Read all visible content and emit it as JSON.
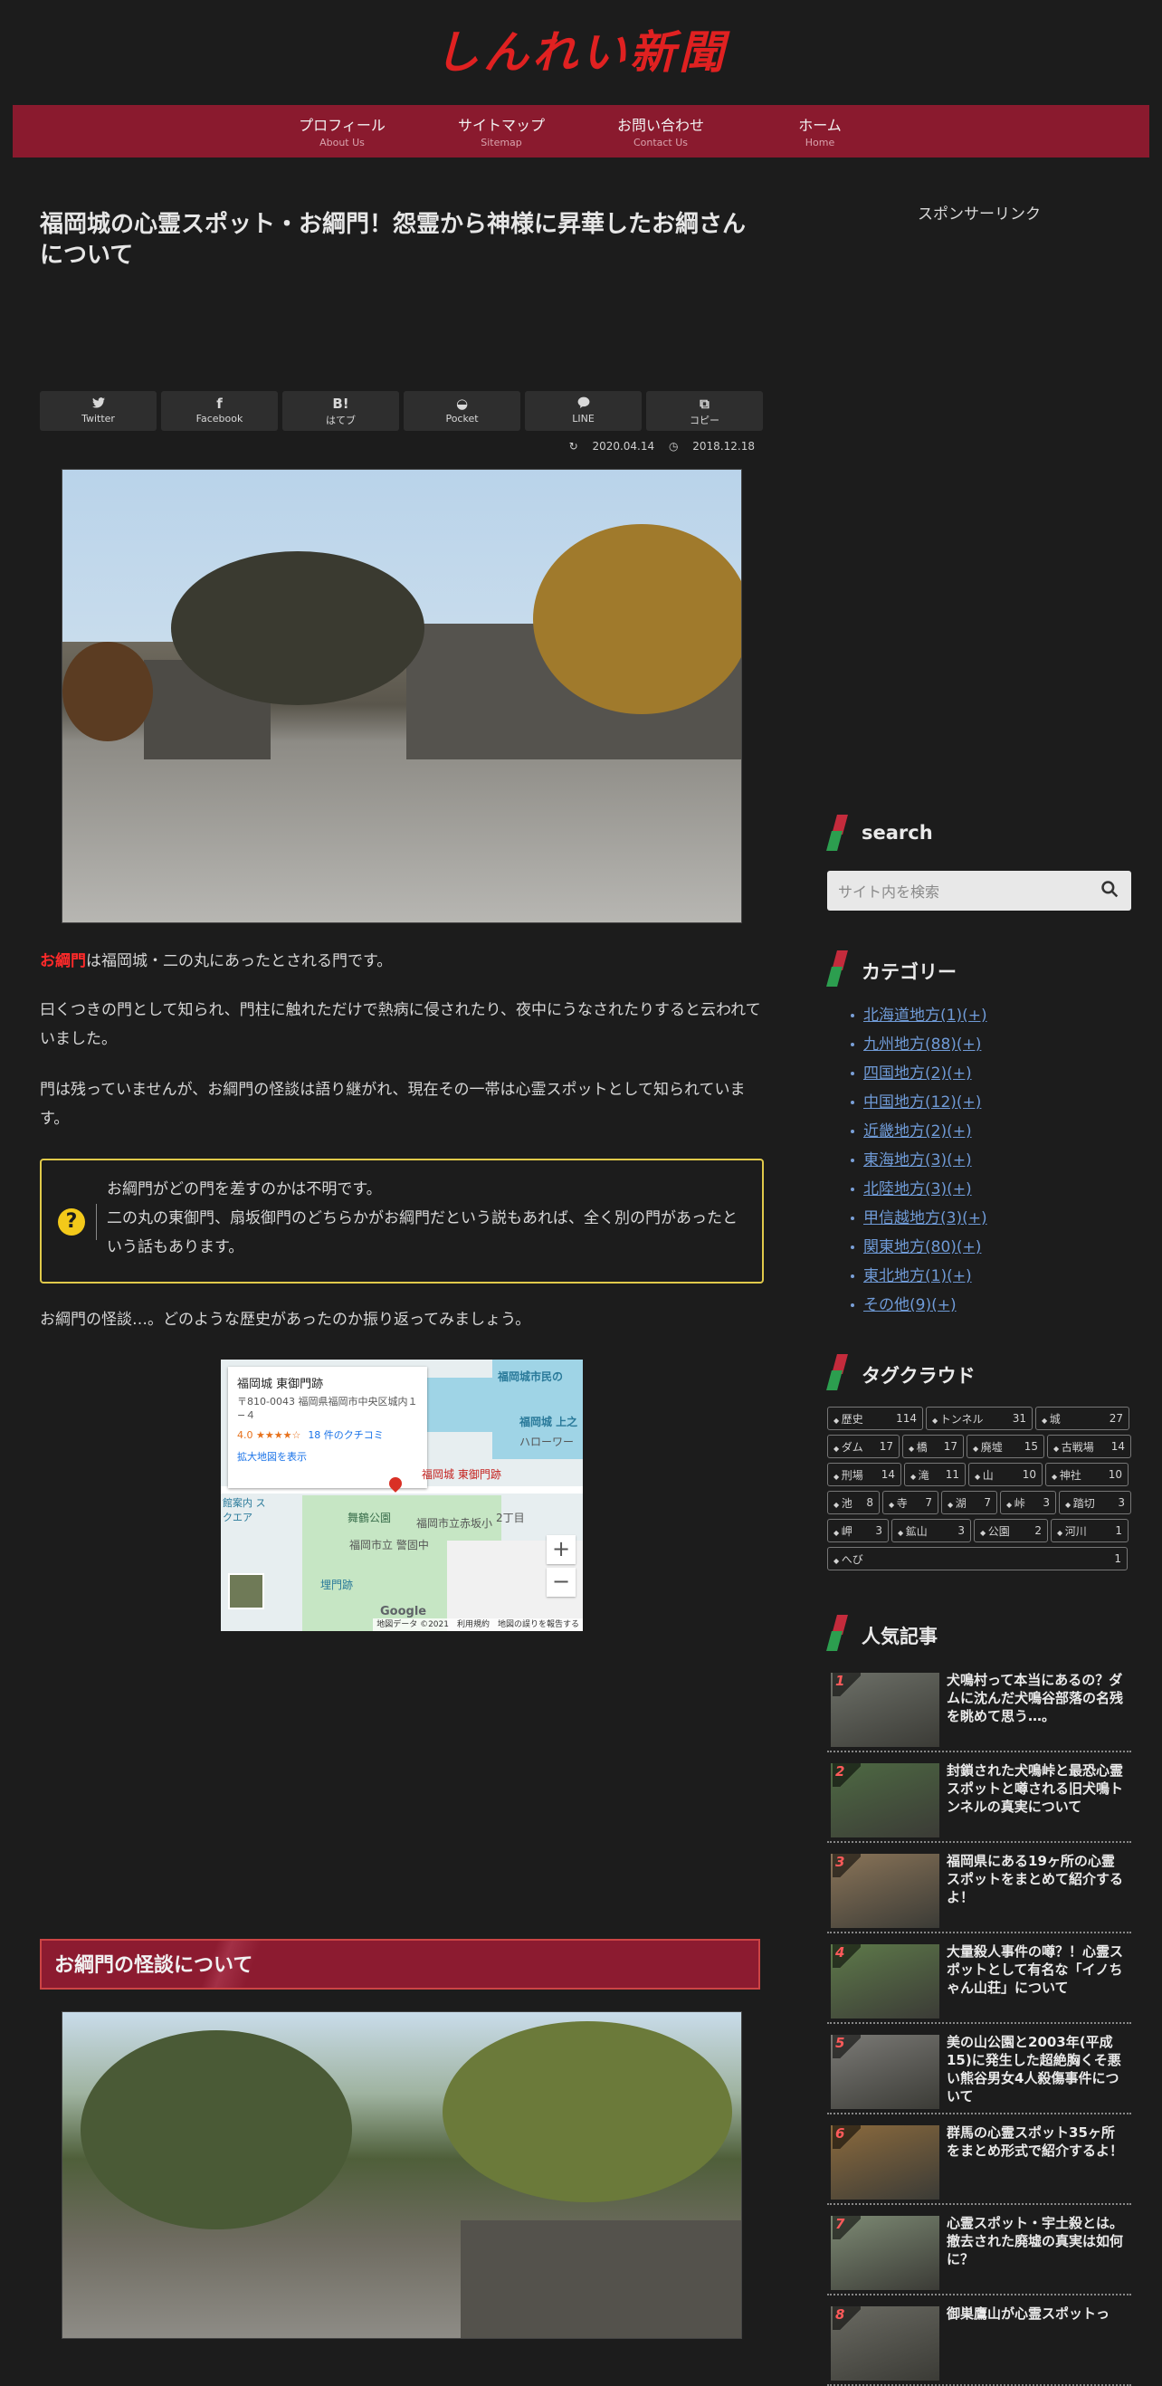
{
  "site": {
    "logo_text": "しんれい新聞",
    "nav": [
      {
        "label": "プロフィール",
        "sub": "About Us"
      },
      {
        "label": "サイトマップ",
        "sub": "Sitemap"
      },
      {
        "label": "お問い合わせ",
        "sub": "Contact Us"
      },
      {
        "label": "ホーム",
        "sub": "Home"
      }
    ]
  },
  "article": {
    "title": "福岡城の心霊スポット・お綱門！怨霊から神様に昇華したお綱さんについて",
    "share": [
      {
        "icon": "twitter-icon",
        "glyph": "🐦",
        "label": "Twitter"
      },
      {
        "icon": "facebook-icon",
        "glyph": "f",
        "label": "Facebook"
      },
      {
        "icon": "hatena-icon",
        "glyph": "B!",
        "label": "はてブ"
      },
      {
        "icon": "pocket-icon",
        "glyph": "◒",
        "label": "Pocket"
      },
      {
        "icon": "line-icon",
        "glyph": "💬",
        "label": "LINE"
      },
      {
        "icon": "copy-icon",
        "glyph": "⧉",
        "label": "コピー"
      }
    ],
    "updated": "2020.04.14",
    "published": "2018.12.18",
    "para1_highlight": "お綱門",
    "para1_rest": "は福岡城・二の丸にあったとされる門です。",
    "para2": "曰くつきの門として知られ、門柱に触れただけで熱病に侵されたり、夜中にうなされたりすると云われていました。",
    "para3": "門は残っていませんが、お綱門の怪談は語り継がれ、現在その一帯は心霊スポットとして知られています。",
    "info_line1": "お綱門がどの門を差すのかは不明です。",
    "info_line2": "二の丸の東御門、扇坂御門のどちらかがお綱門だという説もあれば、全く別の門があったという話もあります。",
    "para4": "お綱門の怪談…。どのような歴史があったのか振り返ってみましょう。",
    "section_heading": "お綱門の怪談について",
    "map": {
      "place_name": "福岡城 東御門跡",
      "address": "〒810-0043 福岡県福岡市中央区城内１−４",
      "rating": "4.0",
      "stars": "★★★★☆",
      "reviews": "18 件のクチコミ",
      "bigger_map": "拡大地図を表示",
      "labels": [
        "福岡城市民の",
        "福岡城 上之",
        "ハローワー",
        "福岡城 東御門跡",
        "舞鶴公園",
        "福岡市立赤坂小",
        "福岡市立 警固中",
        "埋門跡",
        "2丁目",
        "館案内 スクエア"
      ],
      "footer": "地図データ ©2021　利用規約　地図の誤りを報告する",
      "google": "Google"
    }
  },
  "sidebar": {
    "sponsor": "スポンサーリンク",
    "search_title": "search",
    "search_placeholder": "サイト内を検索",
    "category_title": "カテゴリー",
    "categories": [
      "北海道地方(1)(+)",
      "九州地方(88)(+)",
      "四国地方(2)(+)",
      "中国地方(12)(+)",
      "近畿地方(2)(+)",
      "東海地方(3)(+)",
      "北陸地方(3)(+)",
      "甲信越地方(3)(+)",
      "関東地方(80)(+)",
      "東北地方(1)(+)",
      "その他(9)(+)"
    ],
    "tagcloud_title": "タグクラウド",
    "tags": [
      {
        "name": "歴史",
        "count": "114"
      },
      {
        "name": "トンネル",
        "count": "31"
      },
      {
        "name": "城",
        "count": "27"
      },
      {
        "name": "ダム",
        "count": "17"
      },
      {
        "name": "橋",
        "count": "17"
      },
      {
        "name": "廃墟",
        "count": "15"
      },
      {
        "name": "古戦場",
        "count": "14"
      },
      {
        "name": "刑場",
        "count": "14"
      },
      {
        "name": "滝",
        "count": "11"
      },
      {
        "name": "山",
        "count": "10"
      },
      {
        "name": "神社",
        "count": "10"
      },
      {
        "name": "池",
        "count": "8"
      },
      {
        "name": "寺",
        "count": "7"
      },
      {
        "name": "湖",
        "count": "7"
      },
      {
        "name": "峠",
        "count": "3"
      },
      {
        "name": "踏切",
        "count": "3"
      },
      {
        "name": "岬",
        "count": "3"
      },
      {
        "name": "鉱山",
        "count": "3"
      },
      {
        "name": "公園",
        "count": "2"
      },
      {
        "name": "河川",
        "count": "1"
      },
      {
        "name": "へび",
        "count": "1"
      }
    ],
    "popular_title": "人気記事",
    "popular": [
      {
        "rank": "1",
        "title": "犬鳴村って本当にあるの？ダムに沈んだ犬鳴谷部落の名残を眺めて思う…。",
        "color": "#6d7068"
      },
      {
        "rank": "2",
        "title": "封鎖された犬鳴峠と最恐心霊スポットと噂される旧犬鳴トンネルの真実について",
        "color": "#4e6a43"
      },
      {
        "rank": "3",
        "title": "福岡県にある19ヶ所の心霊スポットをまとめて紹介するよ！",
        "color": "#8a7458"
      },
      {
        "rank": "4",
        "title": "大量殺人事件の噂？！心霊スポットとして有名な「イノちゃん山荘」について",
        "color": "#5e7a4a"
      },
      {
        "rank": "5",
        "title": "美の山公園と2003年(平成15)に発生した超絶胸くそ悪い熊谷男女4人殺傷事件について",
        "color": "#7b7a76"
      },
      {
        "rank": "6",
        "title": "群馬の心霊スポット35ヶ所をまとめ形式で紹介するよ！",
        "color": "#8b6a3d"
      },
      {
        "rank": "7",
        "title": "心霊スポット・宇土殺とは。撤去された廃墟の真実は如何に？",
        "color": "#7d8a74"
      },
      {
        "rank": "8",
        "title": "御巣鷹山が心霊スポットっ",
        "color": "#6a6a62"
      }
    ]
  }
}
